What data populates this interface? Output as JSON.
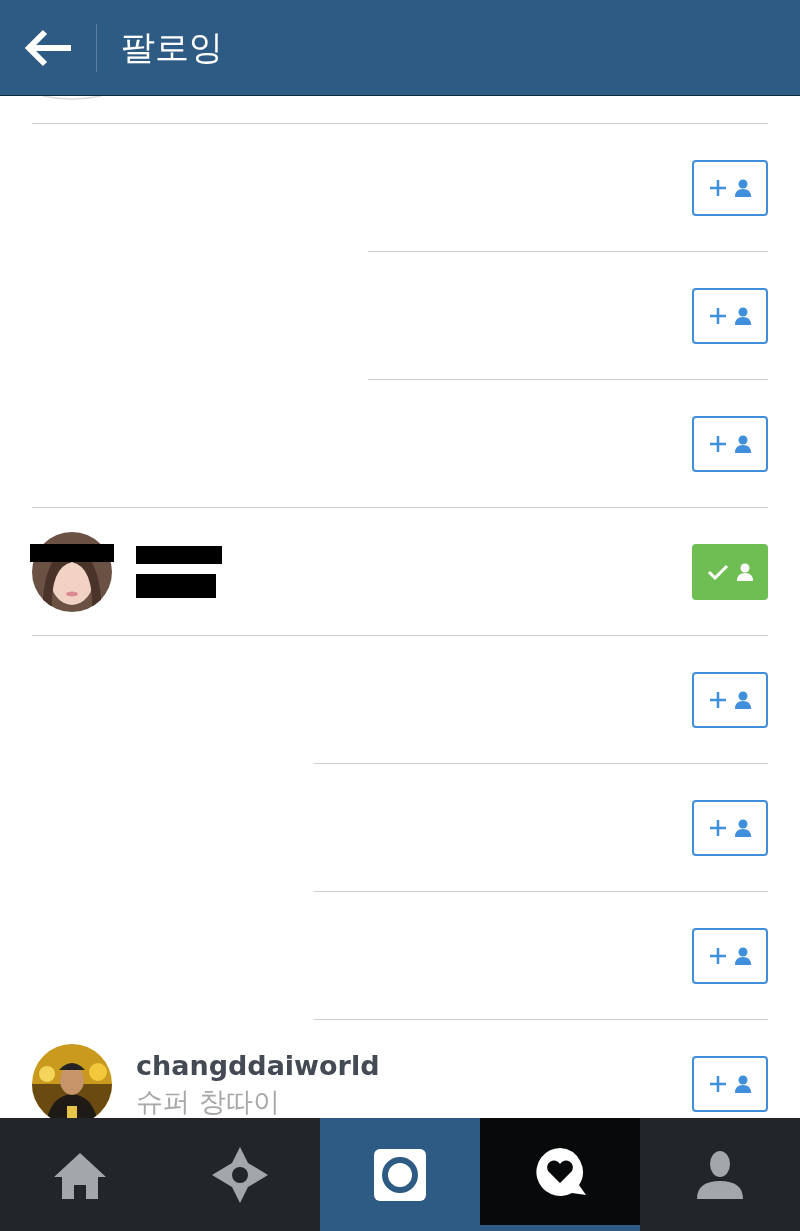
{
  "header": {
    "title": "팔로잉"
  },
  "rows": [
    {
      "kind": "blank",
      "following": false
    },
    {
      "kind": "blank",
      "following": false
    },
    {
      "kind": "blank",
      "following": false
    },
    {
      "kind": "redacted",
      "following": true
    },
    {
      "kind": "blank",
      "following": false
    },
    {
      "kind": "blank",
      "following": false
    },
    {
      "kind": "blank",
      "following": false
    },
    {
      "kind": "user",
      "username": "changddaiworld",
      "full_name": "슈퍼 창따이",
      "following": false
    }
  ],
  "nav": [
    {
      "kind": "home",
      "selected": false
    },
    {
      "kind": "explore",
      "selected": false
    },
    {
      "kind": "camera",
      "selected": false
    },
    {
      "kind": "activity",
      "selected": true
    },
    {
      "kind": "profile",
      "selected": false
    }
  ]
}
